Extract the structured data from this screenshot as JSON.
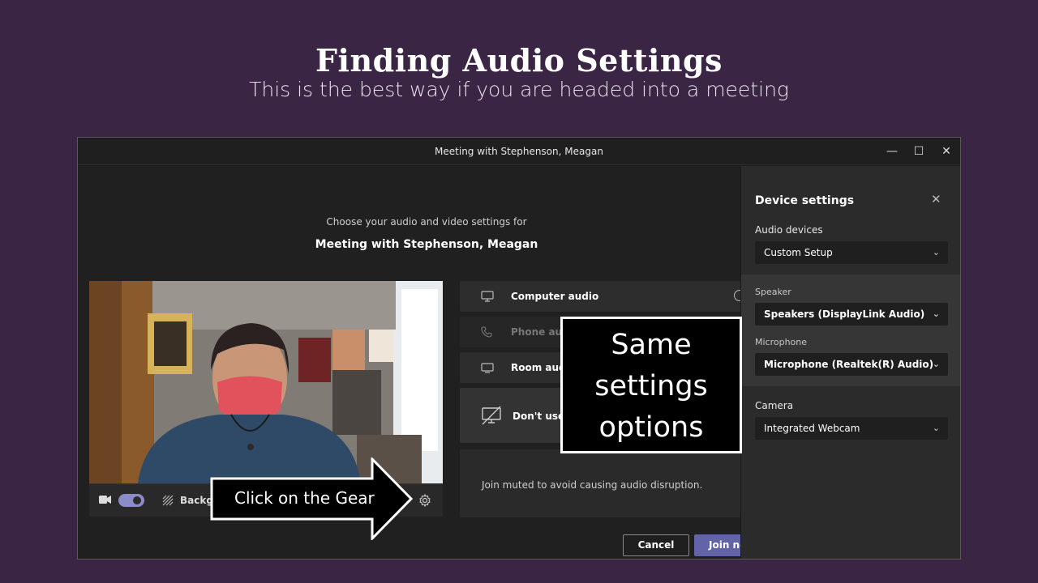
{
  "slide": {
    "title": "Finding Audio Settings",
    "subtitle": "This is the best way if you are headed into a meeting"
  },
  "window": {
    "title": "Meeting with Stephenson, Meagan",
    "controls": {
      "minimize": "—",
      "maximize": "☐",
      "close": "✕"
    }
  },
  "prejoin": {
    "choose_text": "Choose your audio and video settings for",
    "meeting_name": "Meeting with Stephenson, Meagan",
    "video_bar": {
      "background_label": "Backgr"
    },
    "audio_options": [
      {
        "label": "Computer audio",
        "icon": "computer-audio-icon"
      },
      {
        "label": "Phone audi",
        "icon": "phone-icon"
      },
      {
        "label": "Room audi",
        "icon": "room-audio-icon"
      },
      {
        "label": "Don't use a",
        "icon": "no-audio-icon"
      }
    ],
    "muted_text": "Join muted to avoid causing audio disruption.",
    "cancel_label": "Cancel",
    "join_label": "Join no"
  },
  "device_settings": {
    "title": "Device settings",
    "audio_devices_label": "Audio devices",
    "audio_devices_value": "Custom Setup",
    "speaker_label": "Speaker",
    "speaker_value": "Speakers (DisplayLink Audio)",
    "microphone_label": "Microphone",
    "microphone_value": "Microphone (Realtek(R) Audio)",
    "camera_label": "Camera",
    "camera_value": "Integrated Webcam"
  },
  "annotations": {
    "callout_line1": "Same",
    "callout_line2": "settings",
    "callout_line3": "options",
    "arrow_text": "Click on the Gear"
  },
  "colors": {
    "slide_bg": "#3b2544",
    "accent": "#6264a7",
    "toggle": "#8b8cc7"
  }
}
